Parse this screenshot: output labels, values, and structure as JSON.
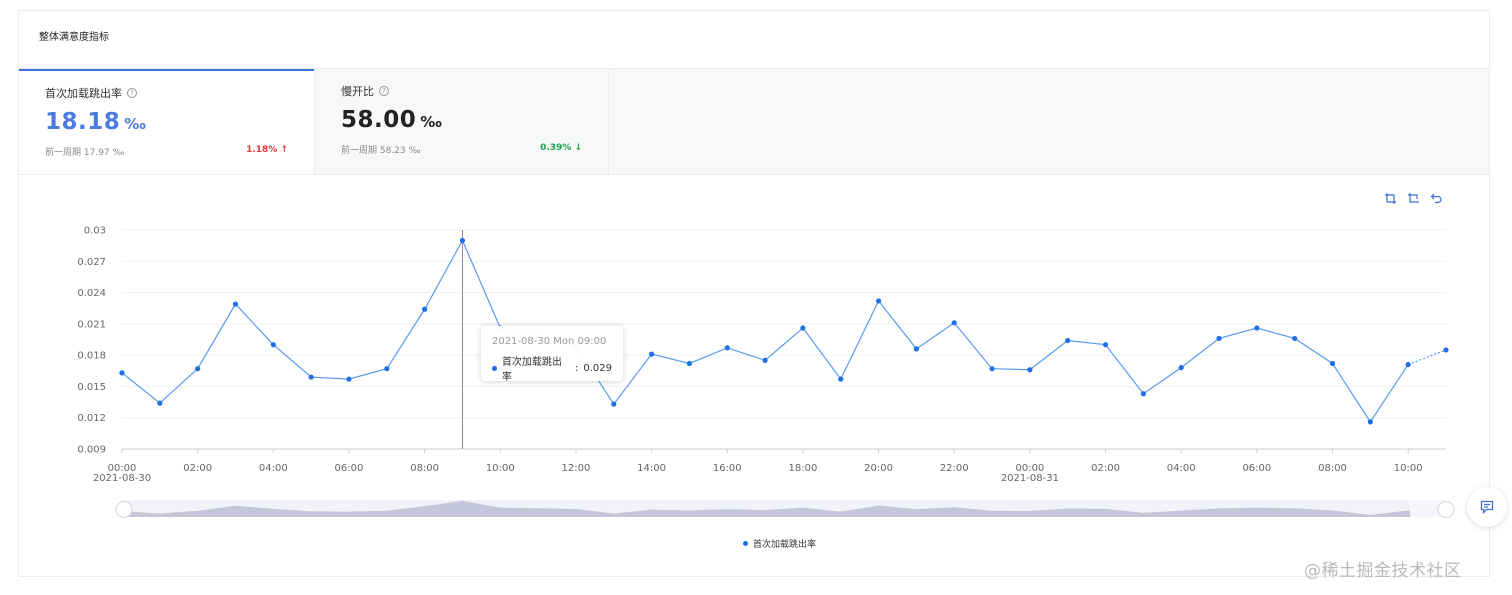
{
  "header": {
    "title": "整体满意度指标"
  },
  "metrics": [
    {
      "label": "首次加载跳出率",
      "value": "18.18",
      "unit": "‰",
      "prev": "前一周期 17.97 ‰",
      "change": "1.18%",
      "direction": "up"
    },
    {
      "label": "慢开比",
      "value": "58.00",
      "unit": "‰",
      "prev": "前一周期 58.23 ‰",
      "change": "0.39%",
      "direction": "down"
    }
  ],
  "icons": {
    "help": "question-circle-icon",
    "zoom": "data-zoom-icon",
    "zoom_reset": "zoom-reset-icon",
    "restore": "restore-icon",
    "feedback": "feedback-icon"
  },
  "colors": {
    "accent": "#4c7be0",
    "series": "#1f6fe5",
    "up": "#e5393a",
    "down": "#21a24e"
  },
  "tooltip": {
    "title": "2021-08-30 Mon 09:00",
    "series": "首次加载跳出率",
    "value": "0.029"
  },
  "watermark": "@稀土掘金技术社区",
  "chart_data": {
    "type": "line",
    "x_ticks": [
      "00:00",
      "02:00",
      "04:00",
      "06:00",
      "08:00",
      "10:00",
      "12:00",
      "14:00",
      "16:00",
      "18:00",
      "20:00",
      "22:00",
      "00:00",
      "02:00",
      "04:00",
      "06:00",
      "08:00",
      "10:00"
    ],
    "x_date_labels": [
      {
        "tick": 0,
        "label": "2021-08-30"
      },
      {
        "tick": 12,
        "label": "2021-08-31"
      }
    ],
    "y_ticks": [
      "0.03",
      "0.027",
      "0.024",
      "0.021",
      "0.018",
      "0.015",
      "0.012",
      "0.009"
    ],
    "ylim": [
      0.009,
      0.03
    ],
    "series": [
      {
        "name": "首次加载跳出率",
        "values": [
          0.0163,
          0.0134,
          0.0167,
          0.0229,
          0.019,
          0.0159,
          0.0157,
          0.0167,
          0.0224,
          0.029,
          0.0206,
          0.0198,
          0.0189,
          0.0133,
          0.0181,
          0.0172,
          0.0187,
          0.0175,
          0.0206,
          0.0157,
          0.0232,
          0.0186,
          0.0211,
          0.0167,
          0.0166,
          0.0194,
          0.019,
          0.0143,
          0.0168,
          0.0196,
          0.0206,
          0.0196,
          0.0172,
          0.0116,
          0.0171,
          0.0185
        ]
      }
    ],
    "dashed_last_segment": true,
    "highlight_index": 9,
    "grid": true,
    "legend_position": "bottom-center",
    "data_zoom": true
  }
}
